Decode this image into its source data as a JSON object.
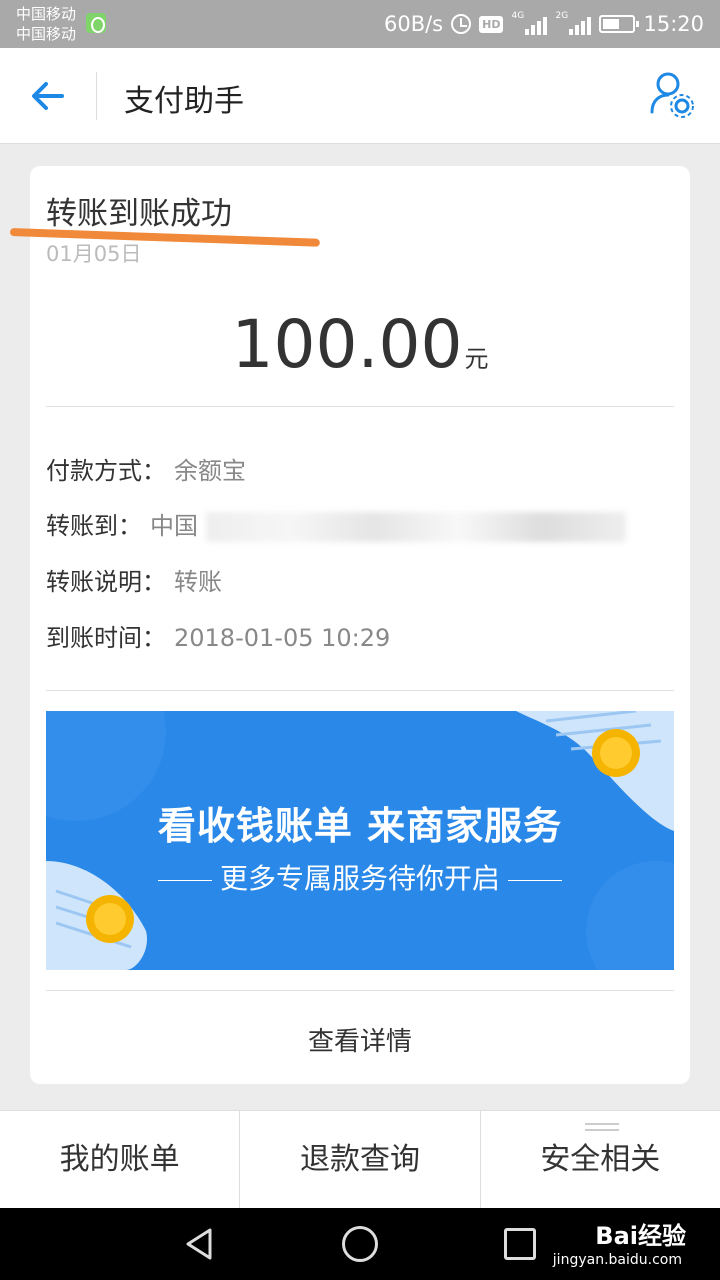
{
  "status_bar": {
    "carrier_1": "中国移动",
    "carrier_2": "中国移动",
    "speed": "60B/s",
    "hd": "HD",
    "net_1": "4G",
    "net_2": "2G",
    "time": "15:20"
  },
  "header": {
    "title": "支付助手"
  },
  "card": {
    "title": "转账到账成功",
    "date": "01月05日",
    "amount": "100.00",
    "amount_unit": "元",
    "rows": [
      {
        "label": "付款方式：",
        "value": "余额宝"
      },
      {
        "label": "转账到：",
        "value": "中国"
      },
      {
        "label": "转账说明：",
        "value": "转账"
      },
      {
        "label": "到账时间：",
        "value": "2018-01-05 10:29"
      }
    ],
    "banner": {
      "title": "看收钱账单  来商家服务",
      "subtitle": "更多专属服务待你开启"
    },
    "details_label": "查看详情"
  },
  "tabs": [
    {
      "label": "我的账单"
    },
    {
      "label": "退款查询"
    },
    {
      "label": "安全相关"
    }
  ],
  "watermark": {
    "brand": "Bai经验",
    "url": "jingyan.baidu.com"
  },
  "colors": {
    "accent": "#1e88e5",
    "banner": "#2a88e8",
    "highlight": "#f08a3a"
  }
}
